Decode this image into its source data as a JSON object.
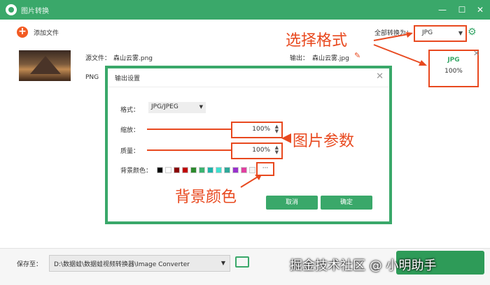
{
  "app": {
    "title": "图片转换"
  },
  "window": {
    "minimize": "—",
    "maximize": "☐",
    "close": "✕"
  },
  "toolbar": {
    "add_files": "添加文件",
    "convert_all_label": "全部转换为：",
    "format_value": "JPG"
  },
  "file": {
    "source_label": "源文件：",
    "source_name": "森山云雾.png",
    "source_format": "PNG",
    "output_label": "输出：",
    "output_name": "森山云雾.jpg",
    "output_format": "JPG",
    "output_quality": "100%"
  },
  "dialog": {
    "title": "输出设置",
    "format_label": "格式：",
    "format_value": "JPG/JPEG",
    "scale_label": "缩放：",
    "scale_value": "100%",
    "quality_label": "质量：",
    "quality_value": "100%",
    "bg_label": "背景颜色：",
    "bg_more": "···",
    "cancel": "取消",
    "ok": "确定",
    "swatches": [
      "#000000",
      "#ffffff",
      "#8b0000",
      "#c00000",
      "#2e8b2e",
      "#3cb371",
      "#20b2aa",
      "#40e0d0",
      "#2fa89a",
      "#9932cc",
      "#e040a0",
      "#f5f5f5"
    ]
  },
  "annotations": {
    "select_format": "选择格式",
    "image_params": "图片参数",
    "bg_color": "背景颜色"
  },
  "bottom": {
    "save_label": "保存至：",
    "path": "D:\\数据蛙\\数据蛙视频转换器\\Image Converter"
  },
  "watermark": "掘金技术社区 @ 小明助手",
  "colors": {
    "accent": "#3aa86a",
    "annotation": "#e8491f"
  },
  "icons": [
    "logo-icon",
    "add-icon",
    "gear-icon",
    "edit-icon",
    "close-icon",
    "folder-icon",
    "chevron-down-icon",
    "spin-updown-icon"
  ]
}
